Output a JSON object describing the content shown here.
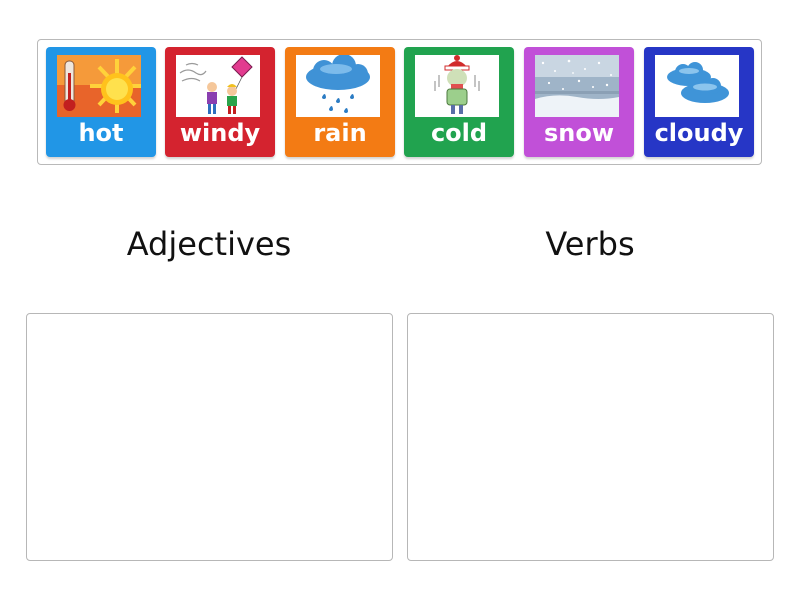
{
  "cards": [
    {
      "id": "hot",
      "label": "hot",
      "color": "#2196e6",
      "icon": "sun-thermometer-icon"
    },
    {
      "id": "windy",
      "label": "windy",
      "color": "#d4232f",
      "icon": "kids-with-kite-icon"
    },
    {
      "id": "rain",
      "label": "rain",
      "color": "#f37b14",
      "icon": "rain-cloud-icon"
    },
    {
      "id": "cold",
      "label": "cold",
      "color": "#21a34f",
      "icon": "shivering-man-icon"
    },
    {
      "id": "snow",
      "label": "snow",
      "color": "#c150d8",
      "icon": "snowfall-icon"
    },
    {
      "id": "cloudy",
      "label": "cloudy",
      "color": "#2636c6",
      "icon": "clouds-icon"
    }
  ],
  "groups": [
    {
      "label": "Adjectives"
    },
    {
      "label": "Verbs"
    }
  ]
}
